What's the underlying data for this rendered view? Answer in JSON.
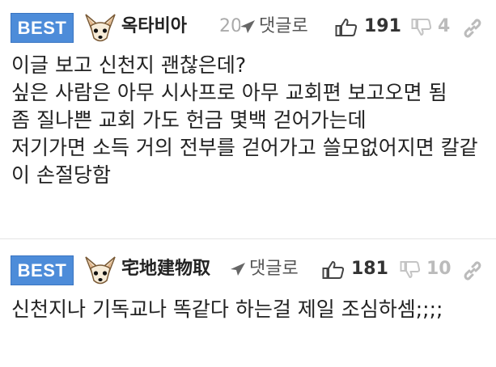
{
  "comments": [
    {
      "badge": "BEST",
      "nickname": "옥타비아",
      "date": "20",
      "reply_label": "댓글로",
      "likes": "191",
      "dislikes": "4",
      "text": "이글 보고 신천지 괜찮은데?\n싶은 사람은 아무 시사프로 아무 교회편 보고오면 됨\n좀 질나쁜 교회 가도 헌금 몇백 걷어가는데\n저기가면 소득 거의 전부를 걷어가고 쓸모없어지면 칼같이 손절당함"
    },
    {
      "badge": "BEST",
      "nickname": "宅地建物取",
      "date": "",
      "reply_label": "댓글로",
      "likes": "181",
      "dislikes": "10",
      "text": "신천지나 기독교나 똑같다 하는걸 제일 조심하셈;;;;"
    }
  ],
  "colors": {
    "badge": "#4d8cd9",
    "muted": "#bbbbbb",
    "divider": "#e4e4e4"
  },
  "icons": {
    "reply": "reply-arrow-icon",
    "like": "thumbs-up-icon",
    "dislike": "thumbs-down-icon",
    "link": "link-icon",
    "avatar": "chihuahua-avatar"
  }
}
